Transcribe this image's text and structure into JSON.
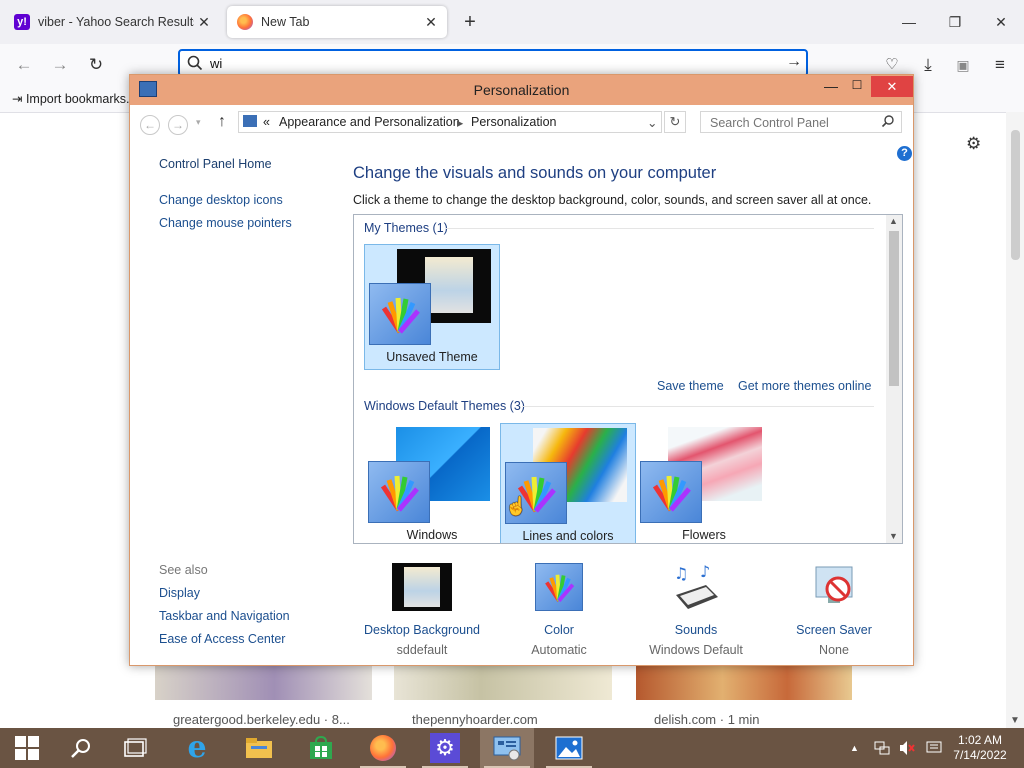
{
  "browser": {
    "tabs": [
      {
        "title": "viber - Yahoo Search Results",
        "icon": "yahoo-icon",
        "active": false
      },
      {
        "title": "New Tab",
        "icon": "firefox-icon",
        "active": true
      }
    ],
    "url_value": "wi",
    "bookmarks_toolbar": {
      "import_label": "Import bookmarks..."
    },
    "cards": [
      {
        "caption": "greatergood.berkeley.edu · 8..."
      },
      {
        "caption": "thepennyhoarder.com"
      },
      {
        "caption": "delish.com · 1 min"
      }
    ]
  },
  "window": {
    "title": "Personalization",
    "breadcrumb": {
      "prefix": "«",
      "items": [
        "Appearance and Personalization",
        "Personalization"
      ]
    },
    "search_placeholder": "Search Control Panel",
    "left_nav": {
      "home": "Control Panel Home",
      "links": [
        "Change desktop icons",
        "Change mouse pointers"
      ],
      "see_also_label": "See also",
      "see_also": [
        "Display",
        "Taskbar and Navigation",
        "Ease of Access Center"
      ]
    },
    "heading": "Change the visuals and sounds on your computer",
    "subheading": "Click a theme to change the desktop background, color, sounds, and screen saver all at once.",
    "my_themes": {
      "label": "My Themes (1)",
      "items": [
        {
          "name": "Unsaved Theme",
          "selected": true
        }
      ]
    },
    "theme_links": {
      "save": "Save theme",
      "more": "Get more themes online"
    },
    "default_themes": {
      "label": "Windows Default Themes (3)",
      "items": [
        {
          "name": "Windows",
          "selected": false
        },
        {
          "name": "Lines and colors",
          "selected": true
        },
        {
          "name": "Flowers",
          "selected": false
        }
      ]
    },
    "bottom": [
      {
        "label": "Desktop Background",
        "value": "sddefault",
        "icon": "desktop-background-icon"
      },
      {
        "label": "Color",
        "value": "Automatic",
        "icon": "color-palette-icon"
      },
      {
        "label": "Sounds",
        "value": "Windows Default",
        "icon": "sounds-icon"
      },
      {
        "label": "Screen Saver",
        "value": "None",
        "icon": "screen-saver-icon"
      }
    ]
  },
  "taskbar": {
    "time": "1:02 AM",
    "date": "7/14/2022",
    "apps": [
      "start-icon",
      "search-icon",
      "task-view-icon",
      "ie-icon",
      "file-explorer-icon",
      "store-icon",
      "firefox-icon",
      "settings-icon",
      "control-panel-icon",
      "photos-icon"
    ]
  },
  "colors": {
    "titlebar": "#eaa37c",
    "link": "#1c4f8f",
    "selection": "#cce8ff",
    "taskbar": "#6a5443"
  }
}
